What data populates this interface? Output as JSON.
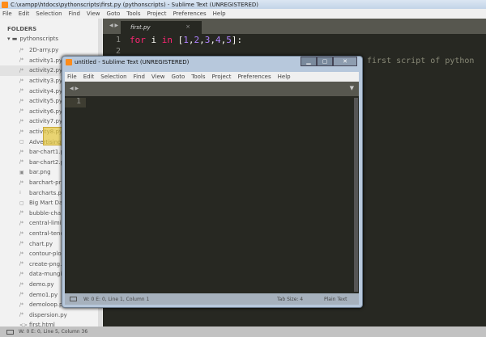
{
  "main_window": {
    "title": "C:\\xampp\\htdocs\\pythonscripts\\first.py (pythonscripts) - Sublime Text (UNREGISTERED)",
    "menu": [
      "File",
      "Edit",
      "Selection",
      "Find",
      "View",
      "Goto",
      "Tools",
      "Project",
      "Preferences",
      "Help"
    ],
    "tab": {
      "label": "first.py",
      "close": "×"
    },
    "lines": [
      "1",
      "2"
    ],
    "code_line1": {
      "kw1": "for",
      "var": " i ",
      "kw2": "in",
      "rest_open": " [",
      "n1": "1",
      "n2": "2",
      "n3": "3",
      "n4": "4",
      "n5": "5",
      "rest_close": "]:"
    },
    "obscured_text": "first script of python",
    "status": "W: 0 E: 0, Line 5, Column 36"
  },
  "sidebar": {
    "header": "FOLDERS",
    "root": "pythonscripts",
    "items": [
      {
        "name": "2D-arry.py",
        "icon": "/*"
      },
      {
        "name": "activity1.py",
        "icon": "/*"
      },
      {
        "name": "activity2.py",
        "icon": "/*"
      },
      {
        "name": "activity3.py",
        "icon": "/*"
      },
      {
        "name": "activity4.py",
        "icon": "/*"
      },
      {
        "name": "activity5.py",
        "icon": "/*"
      },
      {
        "name": "activity6.py",
        "icon": "/*"
      },
      {
        "name": "activity7.py",
        "icon": "/*"
      },
      {
        "name": "activity8.py",
        "icon": "/*"
      },
      {
        "name": "Advertising",
        "icon": "▢"
      },
      {
        "name": "bar-chart1.py",
        "icon": "/*"
      },
      {
        "name": "bar-chart2.py",
        "icon": "/*"
      },
      {
        "name": "bar.png",
        "icon": "▣"
      },
      {
        "name": "barchart-pr",
        "icon": "/*"
      },
      {
        "name": "barcharts.py",
        "icon": "⁞"
      },
      {
        "name": "Big Mart Da",
        "icon": "▢"
      },
      {
        "name": "bubble-cha",
        "icon": "/*"
      },
      {
        "name": "central-limi",
        "icon": "/*"
      },
      {
        "name": "central-tenc",
        "icon": "/*"
      },
      {
        "name": "chart.py",
        "icon": "/*"
      },
      {
        "name": "contour-plo",
        "icon": "/*"
      },
      {
        "name": "create-png.",
        "icon": "/*"
      },
      {
        "name": "data-mungi",
        "icon": "/*"
      },
      {
        "name": "demo.py",
        "icon": "/*"
      },
      {
        "name": "demo1.py",
        "icon": "/*"
      },
      {
        "name": "demoloop.py",
        "icon": "/*"
      },
      {
        "name": "dispersion.py",
        "icon": "/*"
      },
      {
        "name": "first.html",
        "icon": "<>"
      }
    ],
    "selected": "activity2.py"
  },
  "dialog": {
    "title": "untitled - Sublime Text (UNREGISTERED)",
    "menu": [
      "File",
      "Edit",
      "Selection",
      "Find",
      "View",
      "Goto",
      "Tools",
      "Project",
      "Preferences",
      "Help"
    ],
    "lines": [
      "1"
    ],
    "status_left": "W: 0 E: 0, Line 1, Column 1",
    "tab_size": "Tab Size: 4",
    "syntax": "Plain Text",
    "buttons": {
      "minimize": "▁",
      "maximize": "▢",
      "close": "✕"
    }
  }
}
